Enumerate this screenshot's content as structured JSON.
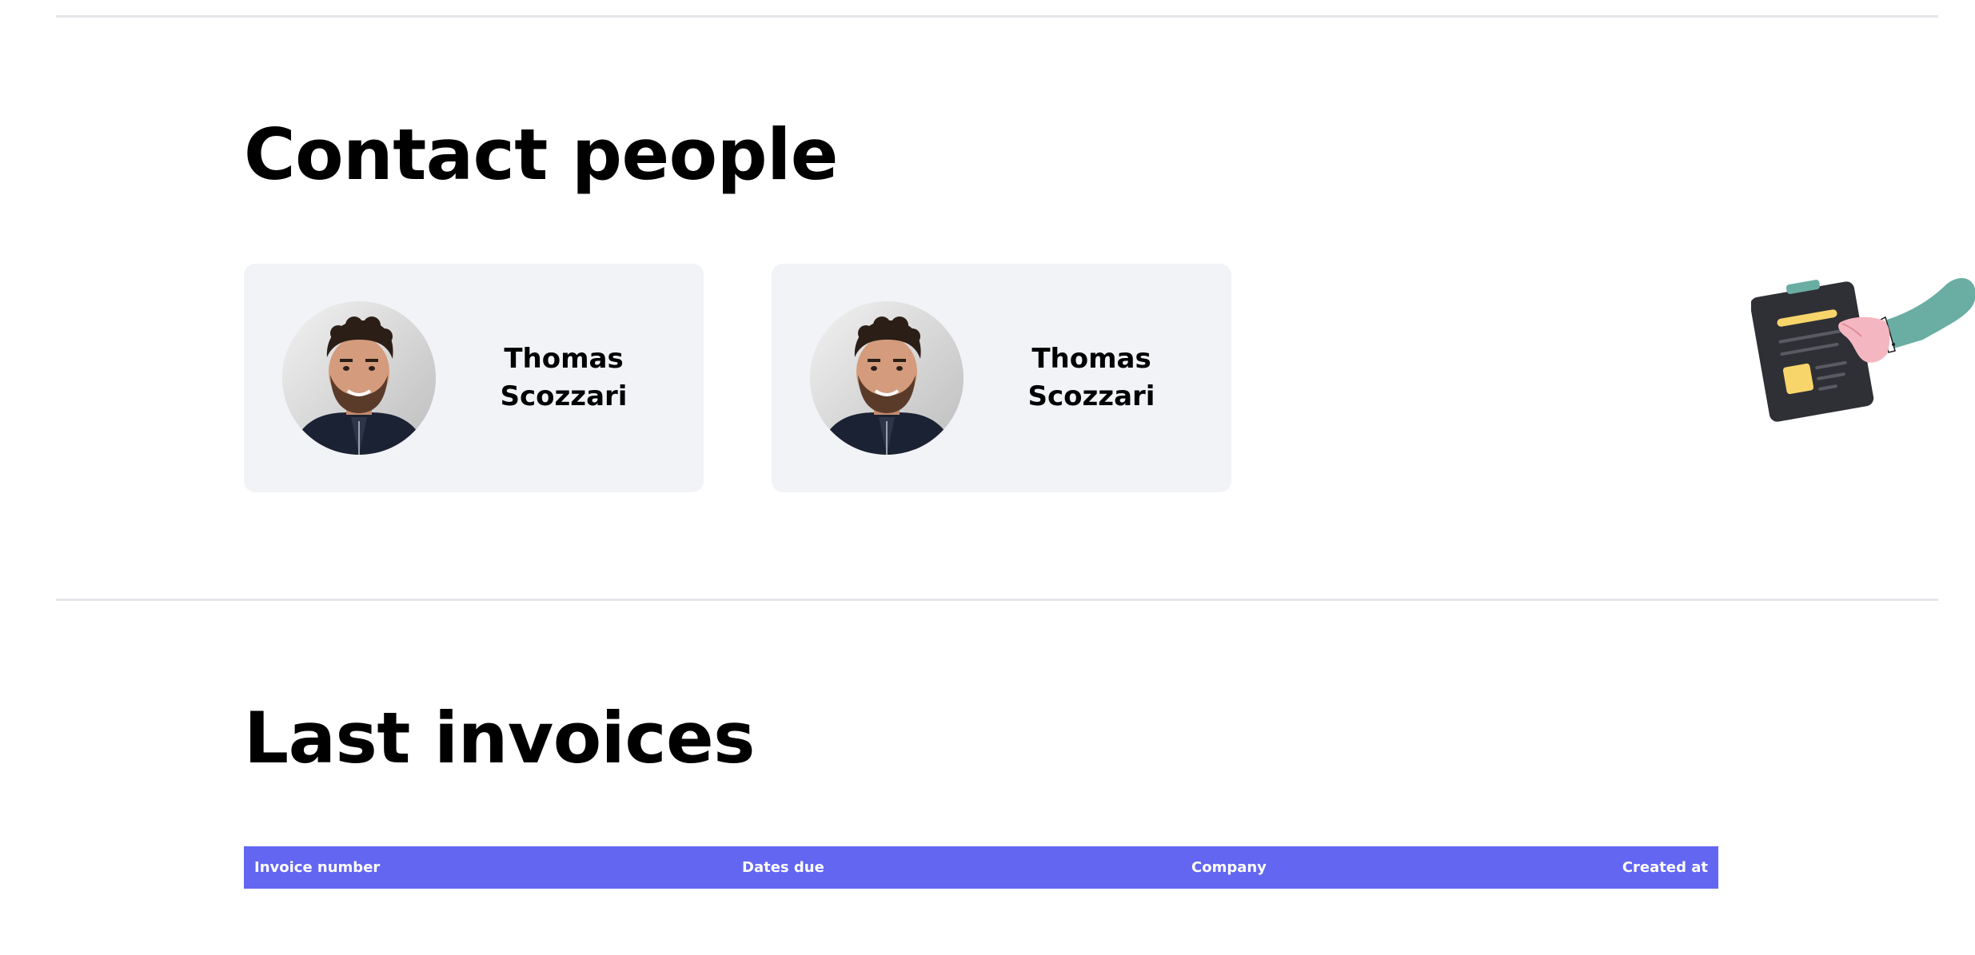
{
  "contacts_section": {
    "title": "Contact people",
    "people": [
      {
        "first_name": "Thomas",
        "last_name": "Scozzari",
        "avatar_icon": "person-photo"
      },
      {
        "first_name": "Thomas",
        "last_name": "Scozzari",
        "avatar_icon": "person-photo"
      }
    ]
  },
  "invoices_section": {
    "title": "Last invoices",
    "columns": [
      "Invoice number",
      "Dates due",
      "Company",
      "Created at"
    ]
  },
  "illustration": {
    "icon": "clipboard-hand-illustration"
  },
  "colors": {
    "accent": "#6366f1",
    "card_background": "#f1f3f7",
    "divider": "#e5e7eb",
    "illustration_sleeve": "#6aada3",
    "illustration_clipboard": "#2f3035",
    "illustration_highlight": "#f8d56a"
  }
}
